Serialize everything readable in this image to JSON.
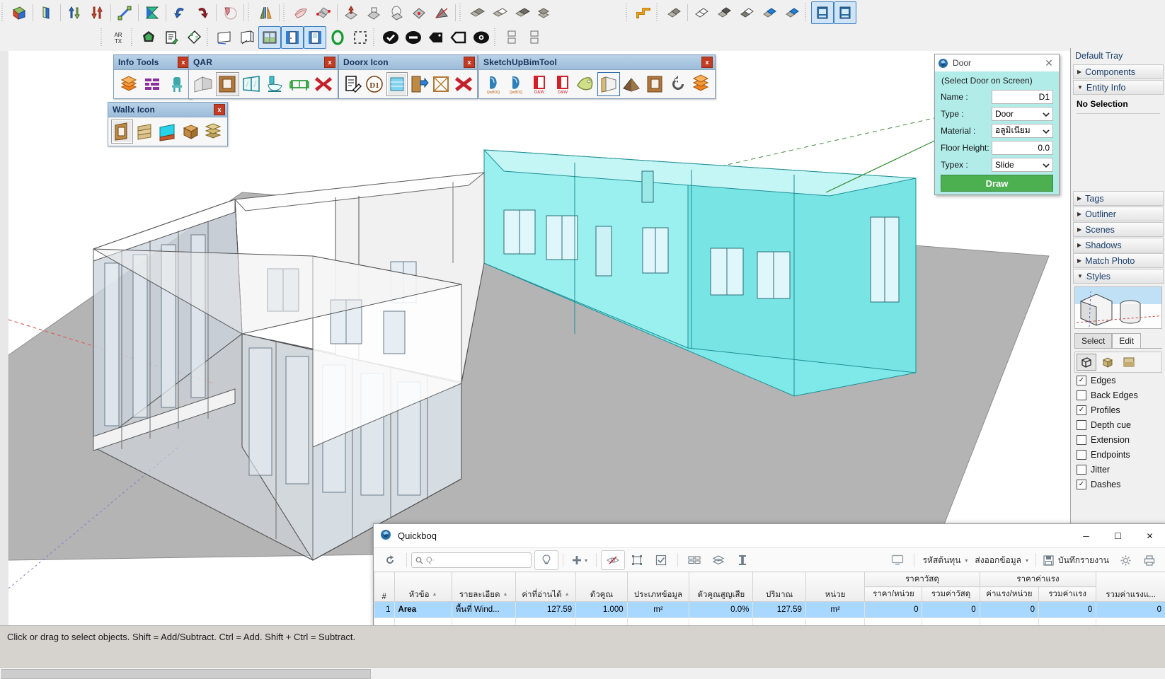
{
  "app": {
    "status_text": "Click or drag to select objects. Shift = Add/Subtract. Ctrl = Add. Shift + Ctrl = Subtract."
  },
  "top_toolbars": {
    "row1": [
      {
        "name": "solid-tools-outer-shell",
        "icon": "outer-shell-icon"
      },
      {
        "name": "solid-tools-intersect",
        "icon": "intersect-faces-icon"
      },
      {
        "name": "flip-along-blue",
        "icon": "flip-blue-icon"
      },
      {
        "name": "flip-along-red",
        "icon": "flip-red-icon"
      },
      {
        "name": "scale-tool",
        "icon": "scale-arrow-icon"
      },
      {
        "name": "mirror-tool",
        "icon": "mirror-icon"
      },
      {
        "name": "rotate-left",
        "icon": "rotate-left-icon"
      },
      {
        "name": "rotate-right",
        "icon": "rotate-right-icon"
      },
      {
        "name": "protractor-tool",
        "icon": "protractor-icon"
      },
      {
        "name": "section-plane-tool",
        "icon": "section-plane-icon"
      },
      {
        "name": "fabric-drape",
        "icon": "drape-icon"
      },
      {
        "name": "grid-tool",
        "icon": "grid-icon"
      },
      {
        "name": "extrude-tool",
        "icon": "extrude-icon"
      },
      {
        "name": "projection-tool",
        "icon": "projection-icon"
      },
      {
        "name": "loop-tool",
        "icon": "loop-icon"
      },
      {
        "name": "target-plane-tool",
        "icon": "target-plane-icon"
      },
      {
        "name": "pyramid-tool",
        "icon": "pyramid-icon"
      },
      {
        "name": "group-copy-tool",
        "icon": "group-copy-icon"
      },
      {
        "name": "group-split-tool",
        "icon": "group-split-icon"
      },
      {
        "name": "group-merge-tool",
        "icon": "group-merge-icon"
      },
      {
        "name": "group-stack-tool",
        "icon": "group-stack-icon"
      }
    ],
    "row1_right": [
      {
        "name": "pipe-route-tool",
        "icon": "pipe-icon"
      },
      {
        "name": "component-solid",
        "icon": "component-solid-icon"
      },
      {
        "name": "component-wire",
        "icon": "component-wire-icon"
      },
      {
        "name": "component-shadow",
        "icon": "component-shadow-icon"
      },
      {
        "name": "component-ghost",
        "icon": "component-ghost-icon"
      },
      {
        "name": "component-blue-a",
        "icon": "component-blue-icon"
      },
      {
        "name": "component-blue-b",
        "icon": "component-blue-icon"
      },
      {
        "name": "building-tool-a",
        "icon": "building-icon"
      },
      {
        "name": "building-tool-b",
        "icon": "building-icon"
      }
    ],
    "row2": [
      {
        "name": "artx-text-tool",
        "icon": "artx-icon",
        "label": "AR TX"
      },
      {
        "name": "quick-nav-tool",
        "icon": "quick-nav-icon"
      },
      {
        "name": "report-edit-tool",
        "icon": "report-edit-icon"
      },
      {
        "name": "price-tag-tool",
        "icon": "price-tag-icon"
      },
      {
        "name": "wall-flat-tool",
        "icon": "wall-flat-icon"
      },
      {
        "name": "wall-corner-tool",
        "icon": "wall-corner-icon"
      },
      {
        "name": "window-tool",
        "icon": "window-icon",
        "selected": true
      },
      {
        "name": "door-plain-tool",
        "icon": "door-plain-icon",
        "selected": true
      },
      {
        "name": "door-glass-tool",
        "icon": "door-glass-icon",
        "selected": true
      },
      {
        "name": "circle-green-tool",
        "icon": "green-ring-icon"
      },
      {
        "name": "marquee-select-tool",
        "icon": "dashed-rect-icon"
      },
      {
        "name": "check-badge-tool",
        "icon": "check-circle-icon"
      },
      {
        "name": "minus-badge-tool",
        "icon": "minus-circle-icon"
      },
      {
        "name": "tag-black-tool",
        "icon": "tag-solid-icon"
      },
      {
        "name": "tag-outline-tool",
        "icon": "tag-outline-icon"
      },
      {
        "name": "eye-badge-tool",
        "icon": "eye-icon"
      },
      {
        "name": "layout-a-tool",
        "icon": "layout-a-icon"
      },
      {
        "name": "layout-b-tool",
        "icon": "layout-b-icon"
      }
    ]
  },
  "palettes": [
    {
      "id": "info-tools",
      "title": "Info Tools",
      "close_label": "x",
      "buttons": [
        {
          "name": "layers-stack-icon"
        },
        {
          "name": "brick-wall-icon"
        },
        {
          "name": "furniture-chair-icon"
        }
      ]
    },
    {
      "id": "qar",
      "title": "QAR",
      "close_label": "x",
      "buttons": [
        {
          "name": "wall-panel-icon"
        },
        {
          "name": "door-panel-icon",
          "selected": true
        },
        {
          "name": "window-panel-icon"
        },
        {
          "name": "toilet-icon"
        },
        {
          "name": "sofa-icon"
        },
        {
          "name": "delete-red-x-icon"
        }
      ]
    },
    {
      "id": "doorx-icon",
      "title": "Doorx Icon",
      "close_label": "x",
      "buttons": [
        {
          "name": "document-edit-icon"
        },
        {
          "name": "d1-badge-icon"
        },
        {
          "name": "window-blue-icon",
          "selected": true
        },
        {
          "name": "door-swing-icon"
        },
        {
          "name": "opening-cross-icon"
        },
        {
          "name": "delete-red-x-icon"
        }
      ]
    },
    {
      "id": "sketchupbimtool",
      "title": "SketchUpBimTool",
      "close_label": "x",
      "buttons": [
        {
          "name": "qb-boq-a-icon",
          "label": "QwickBOQ"
        },
        {
          "name": "qb-boq-b-icon",
          "label": "QwickBOQ"
        },
        {
          "name": "door-window-a-icon",
          "label": "D&W"
        },
        {
          "name": "door-window-b-icon",
          "label": "D&W"
        },
        {
          "name": "tag-label-icon"
        },
        {
          "name": "wall-layer-icon",
          "selected": true
        },
        {
          "name": "roof-icon"
        },
        {
          "name": "door-brown-icon"
        },
        {
          "name": "undo-circle-icon"
        },
        {
          "name": "layers-orange-icon"
        }
      ]
    },
    {
      "id": "wallx-icon",
      "title": "Wallx Icon",
      "close_label": "x",
      "buttons": [
        {
          "name": "wall-door-icon",
          "selected": true
        },
        {
          "name": "wall-layered-icon"
        },
        {
          "name": "wall-cyan-icon"
        },
        {
          "name": "wall-box-icon"
        },
        {
          "name": "wall-stack-icon"
        }
      ]
    }
  ],
  "door_dialog": {
    "title": "Door",
    "icon": "sketchup-logo-icon",
    "close_label": "✕",
    "hint": "(Select Door on Screen)",
    "fields": [
      {
        "label": "Name :",
        "value": "D1",
        "type": "text"
      },
      {
        "label": "Type :",
        "value": "Door",
        "type": "select"
      },
      {
        "label": "Material :",
        "value": "อลูมิเนียม",
        "type": "select"
      },
      {
        "label": "Floor Height:",
        "value": "0.0",
        "type": "text"
      },
      {
        "label": "Typex :",
        "value": "Slide",
        "type": "select"
      }
    ],
    "draw_button": "Draw"
  },
  "tray": {
    "title": "Default Tray",
    "sections": [
      {
        "label": "Components",
        "expanded": false
      },
      {
        "label": "Entity Info",
        "expanded": true
      },
      {
        "label": "Tags",
        "expanded": false
      },
      {
        "label": "Outliner",
        "expanded": false
      },
      {
        "label": "Scenes",
        "expanded": false
      },
      {
        "label": "Shadows",
        "expanded": false
      },
      {
        "label": "Match Photo",
        "expanded": false
      },
      {
        "label": "Styles",
        "expanded": true
      }
    ],
    "entity_info_value": "No Selection",
    "style_tabs": [
      {
        "label": "Select",
        "active": false
      },
      {
        "label": "Edit",
        "active": true
      }
    ],
    "style_icons": [
      {
        "name": "edge-settings-icon",
        "selected": true
      },
      {
        "name": "face-settings-icon",
        "selected": false
      },
      {
        "name": "background-settings-icon",
        "selected": false
      }
    ],
    "checkboxes": [
      {
        "label": "Edges",
        "checked": true
      },
      {
        "label": "Back Edges",
        "checked": false
      },
      {
        "label": "Profiles",
        "checked": true
      },
      {
        "label": "Depth cue",
        "checked": false
      },
      {
        "label": "Extension",
        "checked": false
      },
      {
        "label": "Endpoints",
        "checked": false
      },
      {
        "label": "Jitter",
        "checked": false
      },
      {
        "label": "Dashes",
        "checked": true
      }
    ]
  },
  "quickboq": {
    "title": "Quickboq",
    "icon": "sketchup-logo-icon",
    "window_buttons": {
      "minimize": "─",
      "maximize": "☐",
      "close": "✕"
    },
    "toolbar": {
      "refresh": "refresh-icon",
      "search_placeholder": "Q·",
      "search_value": "",
      "bulb": "lightbulb-icon",
      "add": "plus-icon",
      "add_caret": "▾",
      "visibility": "eye-slash-icon",
      "select_frame": "select-frame-icon",
      "checkbox_tool": "checkbox-icon",
      "brick": "brick-icon",
      "layers": "layers-icon",
      "column": "column-icon",
      "monitor": "monitor-icon",
      "cost_code_label": "รหัสต้นทุน",
      "export_label": "ส่งออกข้อมูล",
      "save_report_label": "บันทึกรายงาน",
      "settings": "gear-icon",
      "print": "print-icon"
    },
    "table": {
      "group_headers": [
        {
          "label": "ราคาวัสดุ",
          "span": 2
        },
        {
          "label": "ราคาค่าแรง",
          "span": 2
        }
      ],
      "columns": [
        {
          "label": "#",
          "sort": false
        },
        {
          "label": "หัวข้อ",
          "sort": true
        },
        {
          "label": "รายละเอียด",
          "sort": true
        },
        {
          "label": "ค่าที่อ่านได้",
          "sort": true
        },
        {
          "label": "ตัวคูณ",
          "sort": false
        },
        {
          "label": "ประเภทข้อมูล",
          "sort": false
        },
        {
          "label": "ตัวคูณสูญเสีย",
          "sort": false
        },
        {
          "label": "ปริมาณ",
          "sort": false
        },
        {
          "label": "หน่วย",
          "sort": false
        },
        {
          "label": "ราคา/หน่วย",
          "sort": false
        },
        {
          "label": "รวมค่าวัสดุ",
          "sort": false
        },
        {
          "label": "ค่าแรง/หน่วย",
          "sort": false
        },
        {
          "label": "รวมค่าแรง",
          "sort": false
        },
        {
          "label": "รวมค่าแรงแ...",
          "sort": false
        }
      ],
      "rows": [
        {
          "num": "1",
          "topic": "Area",
          "detail": "พื้นที่ Wind...",
          "read_value": "127.59",
          "multiplier": "1.000",
          "data_type": "m²",
          "loss_multiplier": "0.0%",
          "quantity": "127.59",
          "unit": "m²",
          "price_per_unit": "0",
          "material_total": "0",
          "labor_per_unit": "0",
          "labor_total": "0",
          "grand_total": "0"
        }
      ]
    }
  }
}
